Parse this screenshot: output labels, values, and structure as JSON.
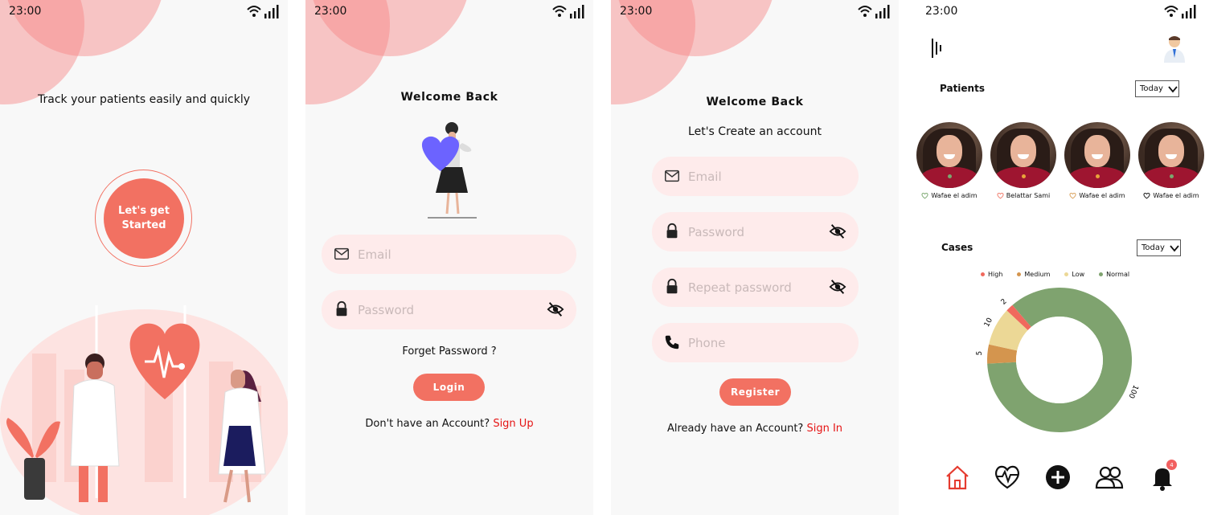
{
  "status_bar": {
    "time": "23:00"
  },
  "onboarding": {
    "tagline": "Track your patients easily and quickly",
    "start_button": "Let's get Started"
  },
  "login": {
    "title": "Welcome Back",
    "email_placeholder": "Email",
    "password_placeholder": "Password",
    "forgot_password": "Forget Password ?",
    "login_button": "Login",
    "no_account_text": "Don't have an Account? ",
    "signup_link": "Sign Up"
  },
  "register": {
    "title": "Welcome Back",
    "subtitle": "Let's Create an account",
    "email_placeholder": "Email",
    "password_placeholder": "Password",
    "repeat_password_placeholder": "Repeat password",
    "phone_placeholder": "Phone",
    "register_button": "Register",
    "have_account_text": "Already have an Account? ",
    "signin_link": "Sign In"
  },
  "dashboard": {
    "patients_title": "Patients",
    "patients_filter": "Today",
    "patients": [
      {
        "name": "Wafae el adim",
        "heart_color": "#7aa86f",
        "dot_color": "#7aa86f"
      },
      {
        "name": "Belattar Sami",
        "heart_color": "#f07a6a",
        "dot_color": "#e8a43a"
      },
      {
        "name": "Wafae el adim",
        "heart_color": "#d9a05a",
        "dot_color": "#e8a43a"
      },
      {
        "name": "Wafae el adim",
        "heart_color": "#111111",
        "dot_color": "#7aa86f"
      }
    ],
    "cases_title": "Cases",
    "cases_filter": "Today",
    "notification_count": "4"
  },
  "chart_data": {
    "type": "pie",
    "subtype": "donut",
    "categories": [
      "High",
      "Medium",
      "Low",
      "Normal"
    ],
    "values": [
      2,
      5,
      10,
      100
    ],
    "data_labels": [
      "2",
      "5",
      "10",
      "100"
    ],
    "colors": [
      "#f0695d",
      "#d4954e",
      "#ecd896",
      "#7fa36f"
    ],
    "legend_position": "top"
  }
}
